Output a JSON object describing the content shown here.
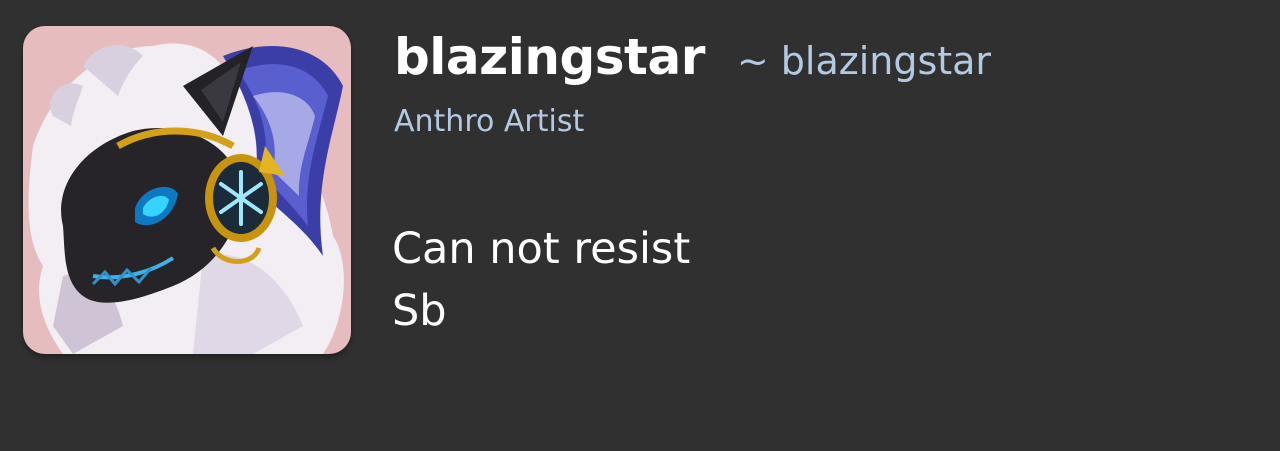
{
  "profile": {
    "display_name": "blazingstar",
    "username": "~ blazingstar",
    "user_title": "Anthro Artist",
    "bio_lines": [
      "Can not resist",
      "Sb"
    ],
    "avatar_alt": "blazingstar"
  },
  "colors": {
    "background": "#303030",
    "name": "#ffffff",
    "accent_link": "#b3c9e3",
    "avatar_bg": "#e6bcbf"
  },
  "icons": {
    "avatar": "character-portrait"
  }
}
